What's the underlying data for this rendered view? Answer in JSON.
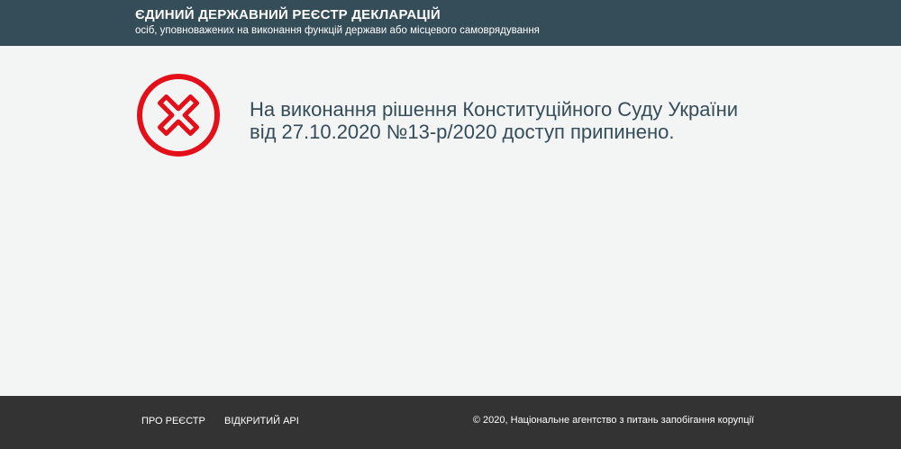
{
  "header": {
    "title": "ЄДИНИЙ ДЕРЖАВНИЙ РЕЄСТР ДЕКЛАРАЦІЙ",
    "subtitle": "осіб, уповноважених на виконання функцій держави або місцевого самоврядування"
  },
  "main": {
    "icon": "error-x-circle-icon",
    "message_line1": "На виконання рішення Конституційного Суду України",
    "message_line2": "від 27.10.2020 №13-р/2020 доступ припинено."
  },
  "footer": {
    "links": [
      {
        "label": "ПРО РЕЄСТР"
      },
      {
        "label": "ВІДКРИТИЙ API"
      }
    ],
    "copyright": "© 2020, Національне агентство з питань запобігання корупції"
  },
  "colors": {
    "header_bg": "#354c59",
    "page_bg": "#f3f5f4",
    "footer_bg": "#333333",
    "error_red": "#e3101a",
    "message_text": "#354c59"
  }
}
